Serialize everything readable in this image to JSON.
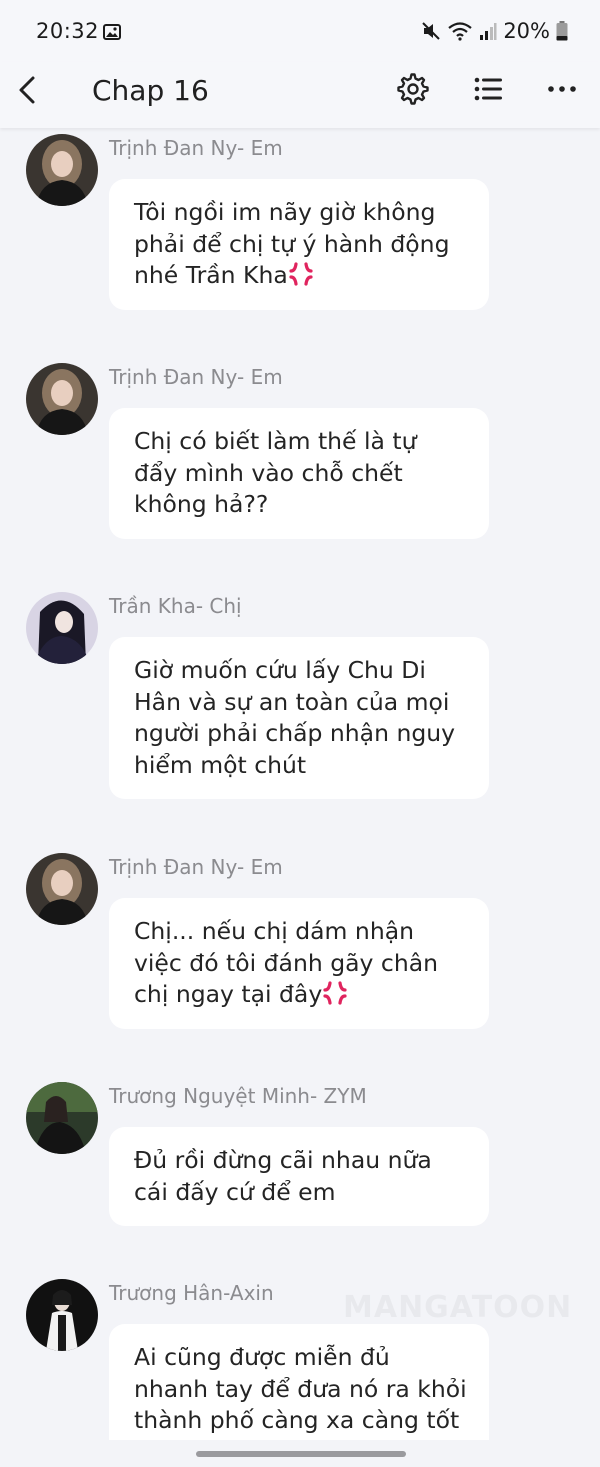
{
  "status_bar": {
    "time": "20:32",
    "battery_text": "20%",
    "icons": [
      "gallery-icon",
      "mute-icon",
      "wifi-icon",
      "signal-icon",
      "battery-icon"
    ]
  },
  "header": {
    "title": "Chap 16",
    "icons": [
      "back-arrow-icon",
      "gear-icon",
      "list-icon",
      "more-dots-icon"
    ]
  },
  "messages": [
    {
      "sender": "Trịnh Đan Ny- Em",
      "text": "Tôi ngồi im nãy giờ không phải để chị tự ý hành động nhé Trần Kha",
      "emoji": "anger-icon"
    },
    {
      "sender": "Trịnh Đan Ny- Em",
      "text": "Chị có biết làm thế là tự đẩy mình vào chỗ chết không hả??"
    },
    {
      "sender": "Trần Kha- Chị",
      "text": "Giờ muốn cứu lấy Chu Di Hân và sự an toàn của mọi người phải chấp nhận nguy hiểm một chút"
    },
    {
      "sender": "Trịnh Đan Ny- Em",
      "text": "Chị... nếu chị dám nhận việc đó tôi đánh gãy chân chị ngay tại đây",
      "emoji": "anger-icon"
    },
    {
      "sender": "Trương Nguyệt Minh- ZYM",
      "text": "Đủ rồi đừng cãi nhau nữa cái đấy cứ để em"
    },
    {
      "sender": "Trương Hân-Axin",
      "text": "Ai cũng được miễn đủ nhanh tay để đưa nó ra khỏi thành phố càng xa càng tốt"
    }
  ],
  "watermark": "MANGATOON",
  "colors": {
    "background": "#f3f4f8",
    "bubble": "#ffffff",
    "sender_text": "#8b8b8f",
    "anger_emoji": "#e0245e"
  }
}
